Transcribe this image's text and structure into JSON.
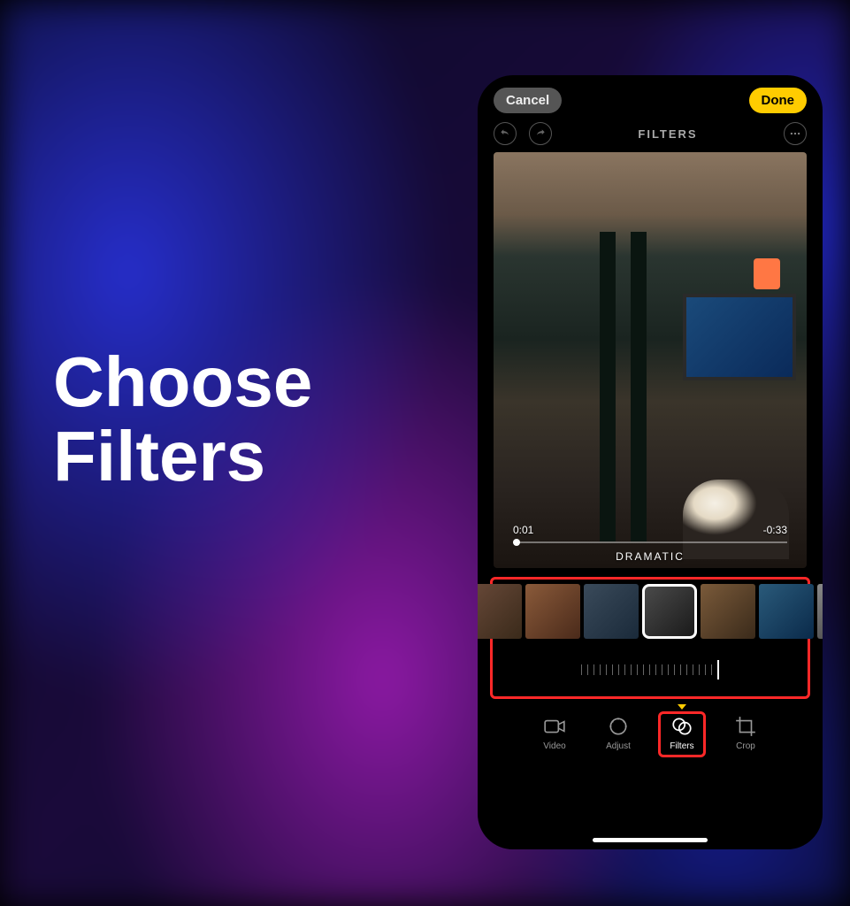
{
  "headline_line1": "Choose",
  "headline_line2": "Filters",
  "topbar": {
    "cancel": "Cancel",
    "done": "Done"
  },
  "subbar": {
    "title": "FILTERS"
  },
  "preview": {
    "time_elapsed": "0:01",
    "time_remaining": "-0:33",
    "filter_name": "DRAMATIC"
  },
  "tabs": {
    "video": "Video",
    "adjust": "Adjust",
    "filters": "Filters",
    "crop": "Crop"
  }
}
